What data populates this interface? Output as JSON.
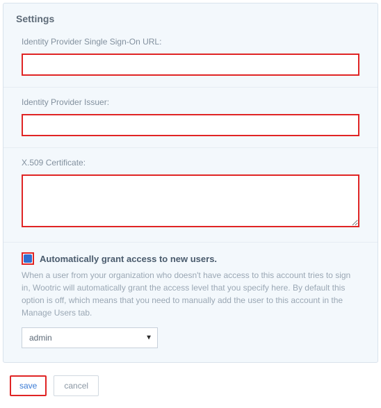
{
  "panel": {
    "title": "Settings"
  },
  "fields": {
    "sso_url": {
      "label": "Identity Provider Single Sign-On URL:",
      "value": ""
    },
    "issuer": {
      "label": "Identity Provider Issuer:",
      "value": ""
    },
    "certificate": {
      "label": "X.509 Certificate:",
      "value": ""
    }
  },
  "auto_grant": {
    "checked": true,
    "label": "Automatically grant access to new users.",
    "help": "When a user from your organization who doesn't have access to this account tries to sign in, Wootric will automatically grant the access level that you specify here. By default this option is off, which means that you need to manually add the user to this account in the Manage Users tab.",
    "role_select": {
      "selected": "admin",
      "options": [
        "admin"
      ]
    }
  },
  "buttons": {
    "save": "save",
    "cancel": "cancel"
  },
  "colors": {
    "highlight_border": "#e02424",
    "panel_bg": "#f3f8fc",
    "accent": "#2f6fd0"
  }
}
